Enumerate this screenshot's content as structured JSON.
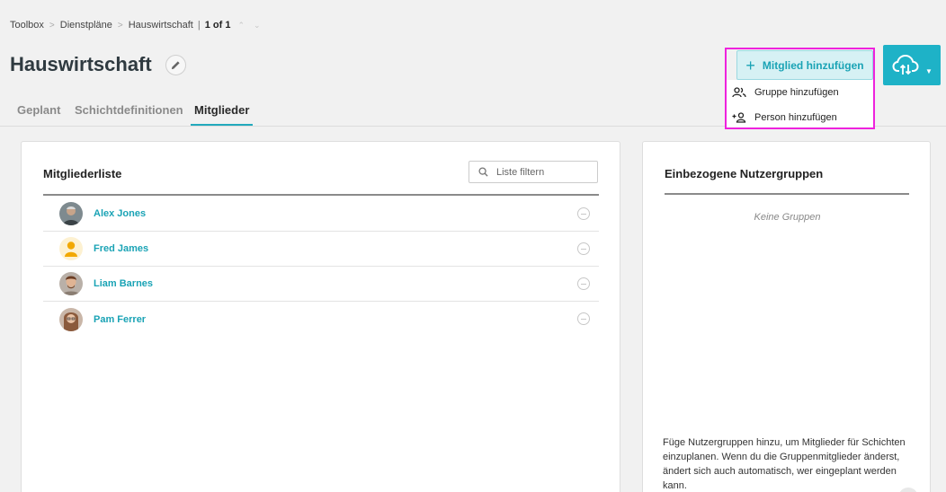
{
  "breadcrumb": {
    "items": [
      "Toolbox",
      "Dienstpläne",
      "Hauswirtschaft"
    ],
    "count": "1 of 1"
  },
  "page": {
    "title": "Hauswirtschaft"
  },
  "tabs": [
    {
      "label": "Geplant",
      "active": false
    },
    {
      "label": "Schichtdefinitionen",
      "active": false
    },
    {
      "label": "Mitglieder",
      "active": true
    }
  ],
  "actions": {
    "add_member_label": "Mitglied hinzufügen",
    "dropdown": [
      {
        "label": "Gruppe hinzufügen",
        "icon": "group-icon"
      },
      {
        "label": "Person hinzufügen",
        "icon": "add-person-icon"
      }
    ],
    "cloud_icon": "cloud-sync-icon"
  },
  "members_card": {
    "title": "Mitgliederliste",
    "filter_placeholder": "Liste filtern",
    "members": [
      {
        "name": "Alex Jones",
        "avatar": "photo"
      },
      {
        "name": "Fred James",
        "avatar": "placeholder"
      },
      {
        "name": "Liam Barnes",
        "avatar": "photo"
      },
      {
        "name": "Pam Ferrer",
        "avatar": "photo"
      }
    ]
  },
  "groups_card": {
    "title": "Einbezogene Nutzergruppen",
    "empty": "Keine Gruppen",
    "hint": "Füge Nutzergruppen hinzu, um Mitglieder für Schichten einzuplanen. Wenn du die Gruppenmitglieder änderst, ändert sich auch automatisch, wer eingeplant werden kann."
  },
  "colors": {
    "accent": "#1eb2c7",
    "link": "#1aa3b5",
    "highlight": "#ee22dd"
  }
}
